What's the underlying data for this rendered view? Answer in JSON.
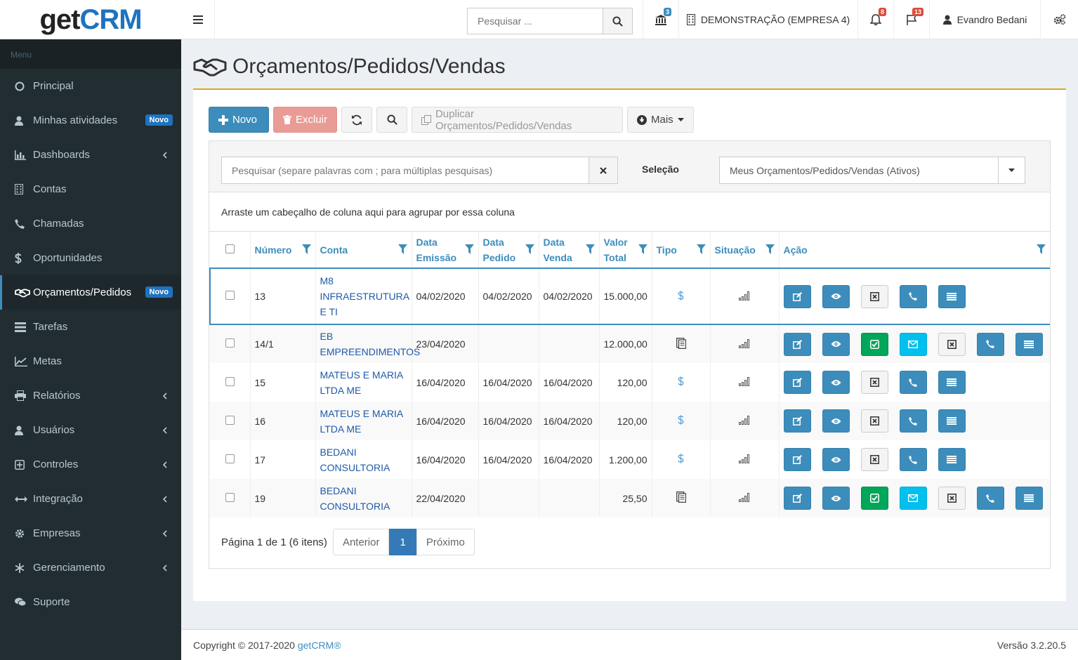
{
  "brand": {
    "part1": "get",
    "part2": "CRM"
  },
  "topbar": {
    "search_placeholder": "Pesquisar ...",
    "bank_badge": "3",
    "company": "DEMONSTRAÇÃO (EMPRESA 4)",
    "bell_badge": "8",
    "flag_badge": "13",
    "user": "Evandro Bedani"
  },
  "sidebar": {
    "header": "Menu",
    "items": [
      {
        "label": "Principal",
        "icon": "circle-icon"
      },
      {
        "label": "Minhas atividades",
        "icon": "user-icon",
        "badge": "Novo"
      },
      {
        "label": "Dashboards",
        "icon": "bar-chart-icon",
        "chevron": true
      },
      {
        "label": "Contas",
        "icon": "building-icon"
      },
      {
        "label": "Chamadas",
        "icon": "phone-icon"
      },
      {
        "label": "Oportunidades",
        "icon": "dollar-icon"
      },
      {
        "label": "Orçamentos/Pedidos",
        "icon": "handshake-icon",
        "badge": "Novo",
        "active": true
      },
      {
        "label": "Tarefas",
        "icon": "tasks-icon"
      },
      {
        "label": "Metas",
        "icon": "line-chart-icon"
      },
      {
        "label": "Relatórios",
        "icon": "print-icon",
        "chevron": true
      },
      {
        "label": "Usuários",
        "icon": "user-icon",
        "chevron": true
      },
      {
        "label": "Controles",
        "icon": "plus-square-icon",
        "chevron": true
      },
      {
        "label": "Integração",
        "icon": "arrows-h-icon",
        "chevron": true
      },
      {
        "label": "Empresas",
        "icon": "gear-icon",
        "chevron": true
      },
      {
        "label": "Gerenciamento",
        "icon": "snowflake-icon",
        "chevron": true
      },
      {
        "label": "Suporte",
        "icon": "comments-icon"
      }
    ]
  },
  "page": {
    "title": "Orçamentos/Pedidos/Vendas"
  },
  "toolbar": {
    "new": "Novo",
    "delete": "Excluir",
    "duplicate": "Duplicar Orçamentos/Pedidos/Vendas",
    "more": "Mais"
  },
  "filter": {
    "search_placeholder": "Pesquisar (separe palavras com ; para múltiplas pesquisas)",
    "selection_label": "Seleção",
    "selection_value": "Meus Orçamentos/Pedidos/Vendas (Ativos)"
  },
  "group_hint": "Arraste um cabeçalho de coluna aqui para agrupar por essa coluna",
  "columns": {
    "numero": "Número",
    "conta": "Conta",
    "data_emissao_1": "Data",
    "data_emissao_2": "Emissão",
    "data_pedido_1": "Data",
    "data_pedido_2": "Pedido",
    "data_venda_1": "Data",
    "data_venda_2": "Venda",
    "valor_1": "Valor",
    "valor_2": "Total",
    "tipo": "Tipo",
    "situacao": "Situação",
    "acao": "Ação"
  },
  "rows": [
    {
      "numero": "13",
      "conta": "M8 INFRAESTRUTURA E TI",
      "emissao": "04/02/2020",
      "pedido": "04/02/2020",
      "venda": "04/02/2020",
      "valor": "15.000,00",
      "tipo": "dollar",
      "full": false
    },
    {
      "numero": "14/1",
      "conta": "EB EMPREENDIMENTOS",
      "emissao": "23/04/2020",
      "pedido": "",
      "venda": "",
      "valor": "12.000,00",
      "tipo": "doc",
      "full": true
    },
    {
      "numero": "15",
      "conta": "MATEUS E MARIA LTDA ME",
      "emissao": "16/04/2020",
      "pedido": "16/04/2020",
      "venda": "16/04/2020",
      "valor": "120,00",
      "tipo": "dollar",
      "full": false
    },
    {
      "numero": "16",
      "conta": "MATEUS E MARIA LTDA ME",
      "emissao": "16/04/2020",
      "pedido": "16/04/2020",
      "venda": "16/04/2020",
      "valor": "120,00",
      "tipo": "dollar",
      "full": false
    },
    {
      "numero": "17",
      "conta": "BEDANI CONSULTORIA",
      "emissao": "16/04/2020",
      "pedido": "16/04/2020",
      "venda": "16/04/2020",
      "valor": "1.200,00",
      "tipo": "dollar",
      "full": false
    },
    {
      "numero": "19",
      "conta": "BEDANI CONSULTORIA",
      "emissao": "22/04/2020",
      "pedido": "",
      "venda": "",
      "valor": "25,50",
      "tipo": "doc",
      "full": true
    }
  ],
  "pager": {
    "info": "Página 1 de 1 (6 itens)",
    "prev": "Anterior",
    "page": "1",
    "next": "Próximo"
  },
  "footer": {
    "copyright": "Copyright © 2017-2020 ",
    "brand_link": "getCRM®",
    "version": "Versão 3.2.20.5"
  },
  "colors": {
    "primary": "#3c8dbc",
    "sidebar": "#222d32",
    "accent_border": "#e0a61b",
    "success": "#00a65a",
    "info": "#00c0ef"
  }
}
